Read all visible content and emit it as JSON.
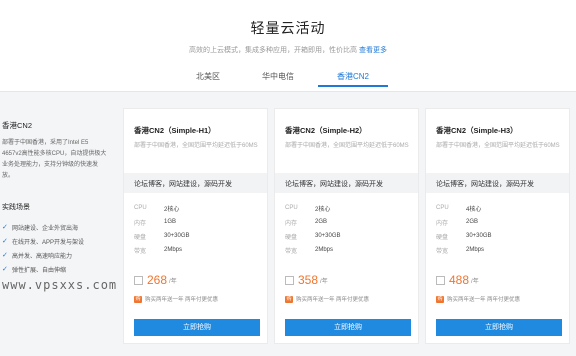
{
  "header": {
    "title": "轻量云活动",
    "subtitle": "高效的上云模式，集成多种应用，开箱即用，性价比高",
    "more_link": "查看更多"
  },
  "tabs": [
    {
      "label": "北美区",
      "active": false
    },
    {
      "label": "华中电信",
      "active": false
    },
    {
      "label": "香港CN2",
      "active": true
    }
  ],
  "sidebar": {
    "title": "香港CN2",
    "description": "部署于中国香港，采用了Intel E5 4657v2高性能多核CPU，自动提供极大业务处理能力，支持分钟级的快速发放。",
    "scenes_title": "实践场景",
    "scenes": [
      "网站建设、企业外贸出海",
      "在线开发、APP开发与架设",
      "高并发、高速响应能力",
      "弹性扩展、自由伸缩"
    ]
  },
  "watermark": "www.vpsxxs.com",
  "accent": "#1f7ad6",
  "price_color": "#f0752f",
  "plans": [
    {
      "name": "香港CN2（Simple-H1）",
      "desc": "部署于中国香港，全国范围平均延迟低于60MS",
      "scene": "论坛博客，网站建设，源码开发",
      "specs": [
        {
          "k": "CPU",
          "v": "2核心"
        },
        {
          "k": "内存",
          "v": "1GB"
        },
        {
          "k": "硬盘",
          "v": "30+30GB"
        },
        {
          "k": "带宽",
          "v": "2Mbps"
        }
      ],
      "price": "268",
      "unit": "/年",
      "promo_icon": "购",
      "promo": "购买两年送一年 两年付更优惠",
      "buy_label": "立即抢购"
    },
    {
      "name": "香港CN2（Simple-H2）",
      "desc": "部署于中国香港，全国范围平均延迟低于60MS",
      "scene": "论坛博客，网站建设，源码开发",
      "specs": [
        {
          "k": "CPU",
          "v": "2核心"
        },
        {
          "k": "内存",
          "v": "2GB"
        },
        {
          "k": "硬盘",
          "v": "30+30GB"
        },
        {
          "k": "带宽",
          "v": "2Mbps"
        }
      ],
      "price": "358",
      "unit": "/年",
      "promo_icon": "购",
      "promo": "购买两年送一年 两年付更优惠",
      "buy_label": "立即抢购"
    },
    {
      "name": "香港CN2（Simple-H3）",
      "desc": "部署于中国香港，全国范围平均延迟低于60MS",
      "scene": "论坛博客，网站建设，源码开发",
      "specs": [
        {
          "k": "CPU",
          "v": "4核心"
        },
        {
          "k": "内存",
          "v": "2GB"
        },
        {
          "k": "硬盘",
          "v": "30+30GB"
        },
        {
          "k": "带宽",
          "v": "2Mbps"
        }
      ],
      "price": "488",
      "unit": "/年",
      "promo_icon": "购",
      "promo": "购买两年送一年 两年付更优惠",
      "buy_label": "立即抢购"
    }
  ]
}
